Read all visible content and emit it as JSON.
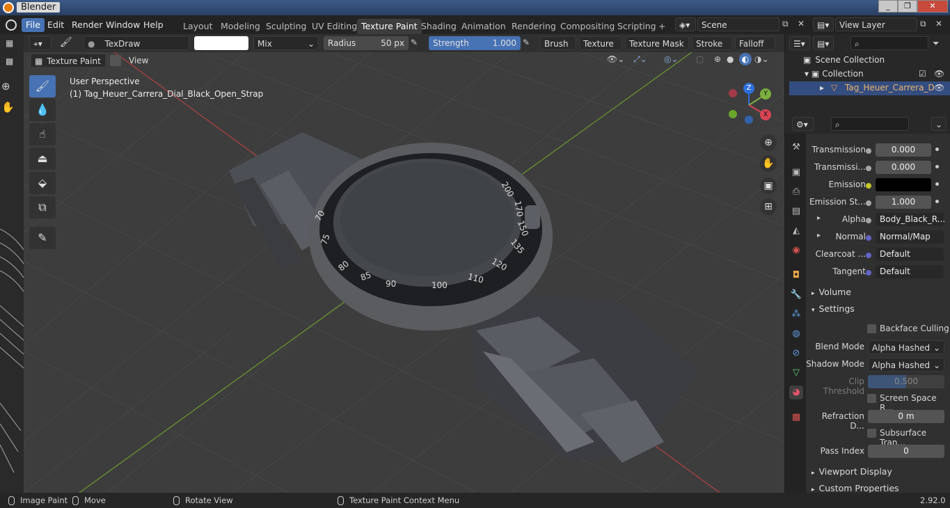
{
  "window": {
    "title": "Blender",
    "min": "_",
    "max": "❐",
    "close": "✕"
  },
  "menus": [
    "File",
    "Edit",
    "Render",
    "Window",
    "Help"
  ],
  "workspaces": [
    "Layout",
    "Modeling",
    "Sculpting",
    "UV Editing",
    "Texture Paint",
    "Shading",
    "Animation",
    "Rendering",
    "Compositing",
    "Scripting",
    "+"
  ],
  "scene": {
    "label": "Scene",
    "viewlayer": "View Layer"
  },
  "toolheader": {
    "brush": "TexDraw",
    "blend": "Mix",
    "radius_label": "Radius",
    "radius_value": "50 px",
    "strength_label": "Strength",
    "strength_value": "1.000",
    "menus": [
      "Brush",
      "Texture",
      "Texture Mask",
      "Stroke",
      "Falloff"
    ]
  },
  "vpheader": {
    "mode": "Texture Paint",
    "view": "View"
  },
  "viewport": {
    "line1": "User Perspective",
    "line2": "(1) Tag_Heuer_Carrera_Dial_Black_Open_Strap"
  },
  "gizmo": {
    "z": "Z",
    "y": "Y",
    "x": "X"
  },
  "bezel": [
    "70",
    "75",
    "80",
    "85",
    "90",
    "100",
    "110",
    "120",
    "135",
    "150",
    "170",
    "200"
  ],
  "outliner": {
    "root": "Scene Collection",
    "collection": "Collection",
    "object": "Tag_Heuer_Carrera_D"
  },
  "props": {
    "rows": [
      {
        "label": "Transmission",
        "value": "0.000"
      },
      {
        "label": "Transmissi...",
        "value": "0.000"
      },
      {
        "label": "Emission",
        "value": ""
      },
      {
        "label": "Emission St...",
        "value": "1.000"
      },
      {
        "label": "Alpha",
        "value": "Body_Black_R..."
      },
      {
        "label": "Normal",
        "value": "Normal/Map"
      },
      {
        "label": "Clearcoat ...",
        "value": "Default"
      },
      {
        "label": "Tangent",
        "value": "Default"
      }
    ],
    "volume": "Volume",
    "settings": "Settings",
    "backface": "Backface Culling",
    "blend_label": "Blend Mode",
    "blend_value": "Alpha Hashed",
    "shadow_label": "Shadow Mode",
    "shadow_value": "Alpha Hashed",
    "clip_label": "Clip Threshold",
    "clip_value": "0.500",
    "ssr": "Screen Space R...",
    "refr_label": "Refraction D...",
    "refr_value": "0 m",
    "sss": "Subsurface Tran...",
    "pass_label": "Pass Index",
    "pass_value": "0",
    "viewport_display": "Viewport Display",
    "custom_props": "Custom Properties"
  },
  "status": {
    "a": "Image Paint",
    "b": "Move",
    "c": "Rotate View",
    "d": "Texture Paint Context Menu",
    "version": "2.92.0"
  },
  "colors": {
    "accent": "#4772b3",
    "emission": "#000000",
    "bg": "#3d3d3d"
  }
}
